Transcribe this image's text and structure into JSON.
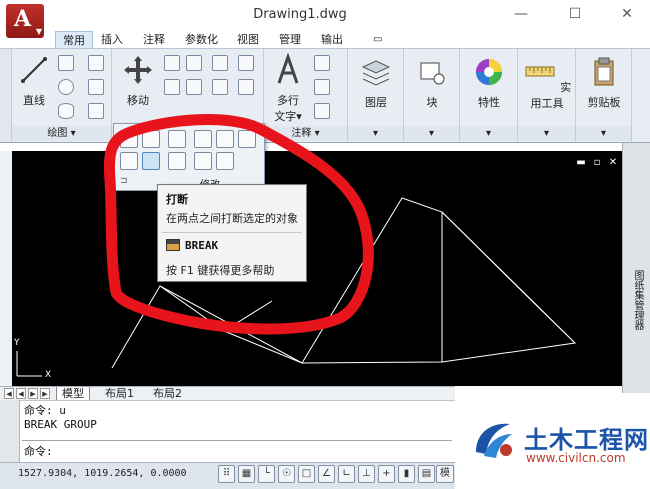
{
  "window": {
    "title": "Drawing1.dwg",
    "app_logo_letter": "A",
    "minimize": "—",
    "maximize": "☐",
    "close": "✕"
  },
  "ribbon_tabs": [
    {
      "label": "常用",
      "active": true
    },
    {
      "label": "插入"
    },
    {
      "label": "注释"
    },
    {
      "label": "参数化"
    },
    {
      "label": "视图"
    },
    {
      "label": "管理"
    },
    {
      "label": "输出"
    }
  ],
  "ribbon_extra": "▭",
  "panels": {
    "draw": {
      "label": "绘图 ▾",
      "line_label": "直线"
    },
    "modify": {
      "move_label": "移动",
      "flyout_label": "修改"
    },
    "annotation": {
      "label": "注释 ▾",
      "mtext_label_1": "多行",
      "mtext_label_2": "文字▾"
    },
    "layers": {
      "label": "图层"
    },
    "block": {
      "label": "块"
    },
    "properties": {
      "label": "特性"
    },
    "utilities": {
      "label": "实用工具"
    },
    "clipboard": {
      "label": "剪贴板"
    }
  },
  "viewport_buttons": [
    "▬",
    "▫",
    "✕"
  ],
  "tooltip": {
    "title": "打断",
    "description": "在两点之间打断选定的对象",
    "command": "BREAK",
    "help": "按 F1 键获得更多帮助"
  },
  "tool_palette_label": "图纸集管理器",
  "ucs": {
    "y": "Y",
    "x": "X"
  },
  "layout_tabs": [
    {
      "label": "模型",
      "active": true
    },
    {
      "label": "布局1"
    },
    {
      "label": "布局2"
    }
  ],
  "command_history": [
    "命令: u",
    "BREAK GROUP"
  ],
  "command_prompt": "命令:",
  "status": {
    "coordinates": "1527.9304, 1019.2654, 0.0000",
    "model_label": "模"
  },
  "watermark": {
    "name": "土木工程网",
    "url": "www.civilcn.com"
  },
  "colors": {
    "annotation_red": "#e8141c",
    "drawing_bg": "#000000",
    "ribbon_bg": "#e8edf3",
    "accent_blue": "#1a53a8"
  }
}
